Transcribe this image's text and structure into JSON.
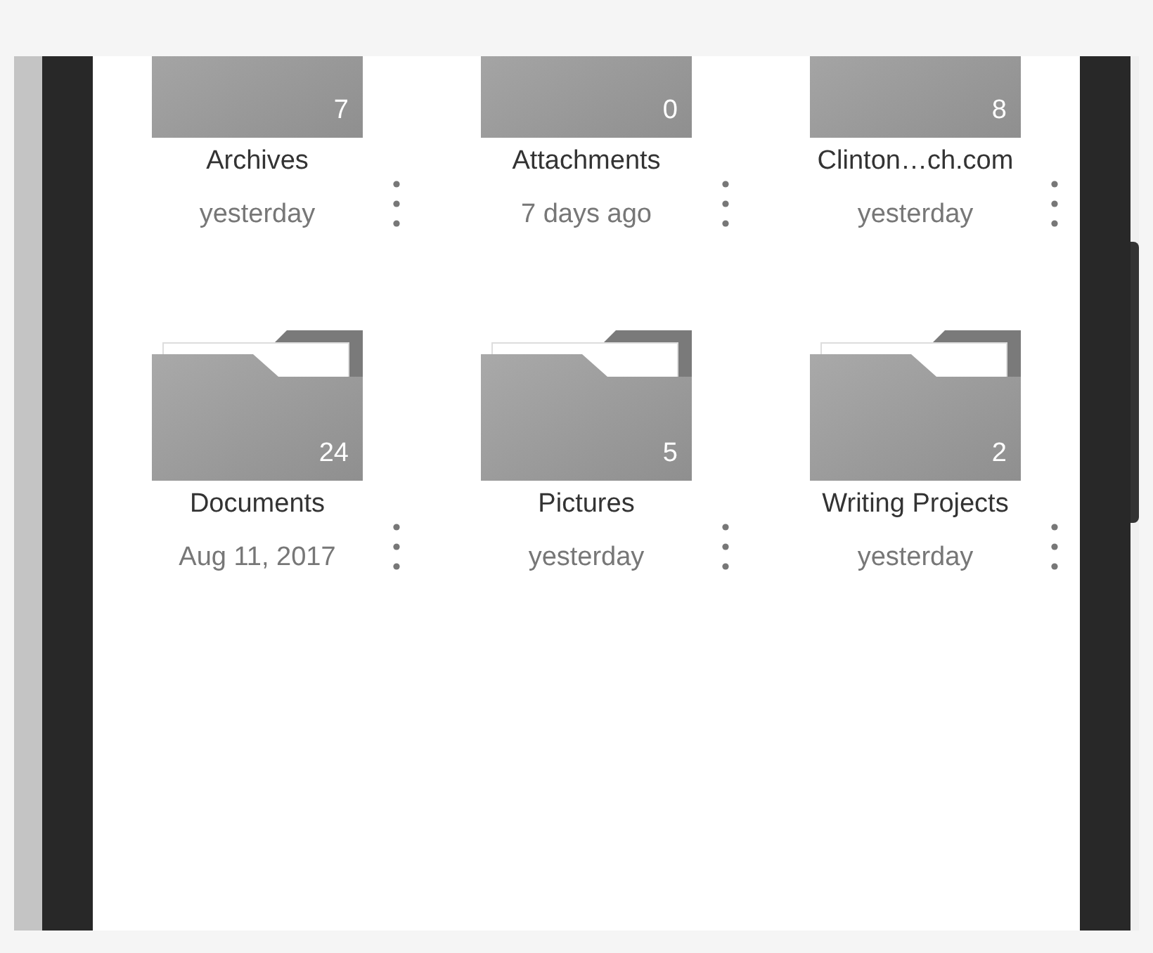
{
  "folders": [
    {
      "name": "Archives",
      "date": "yesterday",
      "count": "7"
    },
    {
      "name": "Attachments",
      "date": "7 days ago",
      "count": "0"
    },
    {
      "name": "Clinton…ch.com",
      "date": "yesterday",
      "count": "8"
    },
    {
      "name": "Documents",
      "date": "Aug 11, 2017",
      "count": "24"
    },
    {
      "name": "Pictures",
      "date": "yesterday",
      "count": "5"
    },
    {
      "name": "Writing Projects",
      "date": "yesterday",
      "count": "2"
    }
  ]
}
